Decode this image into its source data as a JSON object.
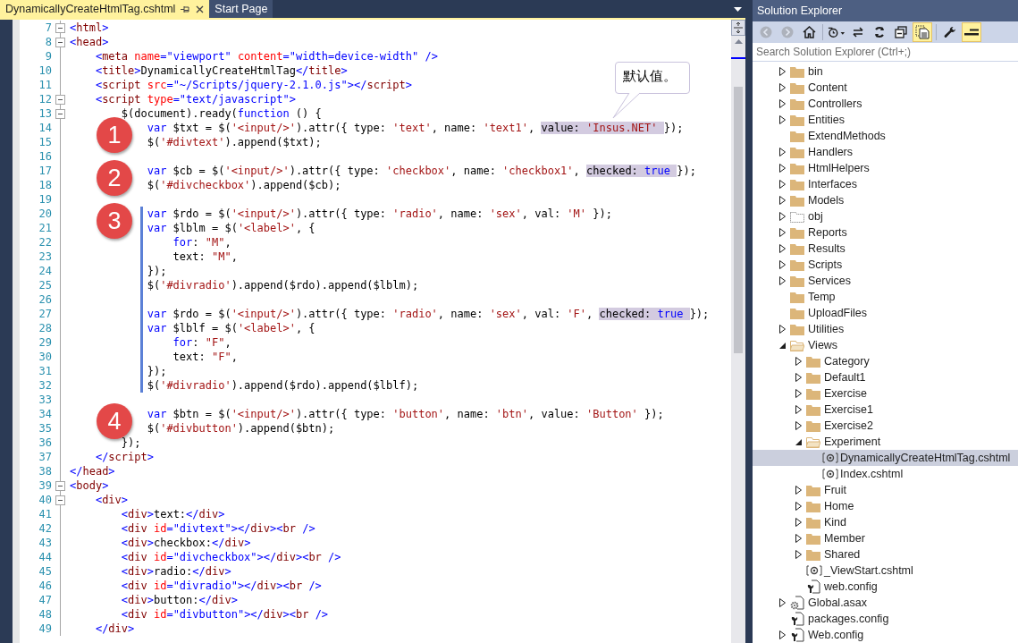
{
  "editor": {
    "tabs": [
      {
        "label": "DynamicallyCreateHtmlTag.cshtml",
        "selected": true
      },
      {
        "label": "Start Page",
        "selected": false
      }
    ],
    "callout": "默认值。",
    "lines": [
      {
        "number": "7",
        "fold": true,
        "changed": false,
        "tokens": [
          {
            "kind": "bracket",
            "text": "<"
          },
          {
            "kind": "tag",
            "text": "html"
          },
          {
            "kind": "bracket",
            "text": ">"
          }
        ]
      },
      {
        "number": "8",
        "fold": true,
        "changed": false,
        "tokens": [
          {
            "kind": "bracket",
            "text": "<"
          },
          {
            "kind": "tag",
            "text": "head"
          },
          {
            "kind": "bracket",
            "text": ">"
          }
        ]
      },
      {
        "number": "9",
        "fold": false,
        "changed": false,
        "tokens": [
          {
            "kind": "bracket",
            "text": "    <"
          },
          {
            "kind": "tag",
            "text": "meta"
          },
          {
            "kind": "attr",
            "text": " name"
          },
          {
            "kind": "bracket",
            "text": "="
          },
          {
            "kind": "attrval",
            "text": "\"viewport\""
          },
          {
            "kind": "attr",
            "text": " content"
          },
          {
            "kind": "bracket",
            "text": "="
          },
          {
            "kind": "attrval",
            "text": "\"width=device-width\""
          },
          {
            "kind": "bracket",
            "text": " />"
          }
        ]
      },
      {
        "number": "10",
        "fold": false,
        "changed": false,
        "tokens": [
          {
            "kind": "bracket",
            "text": "    <"
          },
          {
            "kind": "tag",
            "text": "title"
          },
          {
            "kind": "bracket",
            "text": ">"
          },
          {
            "kind": "plain",
            "text": "DynamicallyCreateHtmlTag"
          },
          {
            "kind": "bracket",
            "text": "</"
          },
          {
            "kind": "tag",
            "text": "title"
          },
          {
            "kind": "bracket",
            "text": ">"
          }
        ]
      },
      {
        "number": "11",
        "fold": false,
        "changed": false,
        "tokens": [
          {
            "kind": "bracket",
            "text": "    <"
          },
          {
            "kind": "tag",
            "text": "script"
          },
          {
            "kind": "attr",
            "text": " src"
          },
          {
            "kind": "bracket",
            "text": "="
          },
          {
            "kind": "attrval",
            "text": "\"~/Scripts/jquery-2.1.0.js\""
          },
          {
            "kind": "bracket",
            "text": "></"
          },
          {
            "kind": "tag",
            "text": "script"
          },
          {
            "kind": "bracket",
            "text": ">"
          }
        ]
      },
      {
        "number": "12",
        "fold": true,
        "changed": false,
        "tokens": [
          {
            "kind": "bracket",
            "text": "    <"
          },
          {
            "kind": "tag",
            "text": "script"
          },
          {
            "kind": "attr",
            "text": " type"
          },
          {
            "kind": "bracket",
            "text": "="
          },
          {
            "kind": "attrval",
            "text": "\"text/javascript\""
          },
          {
            "kind": "bracket",
            "text": ">"
          }
        ]
      },
      {
        "number": "13",
        "fold": true,
        "changed": false,
        "tokens": [
          {
            "kind": "plain",
            "text": "        $(document).ready("
          },
          {
            "kind": "keyword",
            "text": "function"
          },
          {
            "kind": "plain",
            "text": " () {"
          }
        ]
      },
      {
        "number": "14",
        "fold": false,
        "changed": false,
        "badge": "1",
        "tokens": [
          {
            "kind": "keyword",
            "text": "            var"
          },
          {
            "kind": "plain",
            "text": " $txt = $("
          },
          {
            "kind": "string",
            "text": "'<input/>'"
          },
          {
            "kind": "plain",
            "text": ").attr({ type: "
          },
          {
            "kind": "string",
            "text": "'text'"
          },
          {
            "kind": "plain",
            "text": ", name: "
          },
          {
            "kind": "string",
            "text": "'text1'"
          },
          {
            "kind": "plain",
            "text": ", "
          },
          {
            "kind": "mark",
            "parts": [
              {
                "kind": "plain",
                "text": "value: "
              },
              {
                "kind": "string",
                "text": "'Insus.NET' "
              }
            ]
          },
          {
            "kind": "plain",
            "text": "});"
          }
        ]
      },
      {
        "number": "15",
        "fold": false,
        "changed": false,
        "tokens": [
          {
            "kind": "plain",
            "text": "            $("
          },
          {
            "kind": "string",
            "text": "'#divtext'"
          },
          {
            "kind": "plain",
            "text": ").append($txt);"
          }
        ]
      },
      {
        "number": "16",
        "fold": false,
        "changed": false
      },
      {
        "number": "17",
        "fold": false,
        "changed": false,
        "badge": "2",
        "tokens": [
          {
            "kind": "keyword",
            "text": "            var"
          },
          {
            "kind": "plain",
            "text": " $cb = $("
          },
          {
            "kind": "string",
            "text": "'<input/>'"
          },
          {
            "kind": "plain",
            "text": ").attr({ type: "
          },
          {
            "kind": "string",
            "text": "'checkbox'"
          },
          {
            "kind": "plain",
            "text": ", name: "
          },
          {
            "kind": "string",
            "text": "'checkbox1'"
          },
          {
            "kind": "plain",
            "text": ", "
          },
          {
            "kind": "mark",
            "parts": [
              {
                "kind": "plain",
                "text": "checked: "
              },
              {
                "kind": "keyword",
                "text": "true "
              }
            ]
          },
          {
            "kind": "plain",
            "text": "});"
          }
        ]
      },
      {
        "number": "18",
        "fold": false,
        "changed": false,
        "tokens": [
          {
            "kind": "plain",
            "text": "            $("
          },
          {
            "kind": "string",
            "text": "'#divcheckbox'"
          },
          {
            "kind": "plain",
            "text": ").append($cb);"
          }
        ]
      },
      {
        "number": "19",
        "fold": false,
        "changed": false
      },
      {
        "number": "20",
        "fold": false,
        "changed": true,
        "badge": "3",
        "tokens": [
          {
            "kind": "keyword",
            "text": "            var"
          },
          {
            "kind": "plain",
            "text": " $rdo = $("
          },
          {
            "kind": "string",
            "text": "'<input/>'"
          },
          {
            "kind": "plain",
            "text": ").attr({ type: "
          },
          {
            "kind": "string",
            "text": "'radio'"
          },
          {
            "kind": "plain",
            "text": ", name: "
          },
          {
            "kind": "string",
            "text": "'sex'"
          },
          {
            "kind": "plain",
            "text": ", val: "
          },
          {
            "kind": "string",
            "text": "'M'"
          },
          {
            "kind": "plain",
            "text": " });"
          }
        ]
      },
      {
        "number": "21",
        "fold": false,
        "changed": true,
        "tokens": [
          {
            "kind": "keyword",
            "text": "            var"
          },
          {
            "kind": "plain",
            "text": " $lblm = $("
          },
          {
            "kind": "string",
            "text": "'<label>'"
          },
          {
            "kind": "plain",
            "text": ", {"
          }
        ]
      },
      {
        "number": "22",
        "fold": false,
        "changed": true,
        "tokens": [
          {
            "kind": "keyword",
            "text": "                for"
          },
          {
            "kind": "plain",
            "text": ": "
          },
          {
            "kind": "string",
            "text": "\"M\""
          },
          {
            "kind": "plain",
            "text": ","
          }
        ]
      },
      {
        "number": "23",
        "fold": false,
        "changed": true,
        "tokens": [
          {
            "kind": "plain",
            "text": "                text: "
          },
          {
            "kind": "string",
            "text": "\"M\""
          },
          {
            "kind": "plain",
            "text": ","
          }
        ]
      },
      {
        "number": "24",
        "fold": false,
        "changed": true,
        "tokens": [
          {
            "kind": "plain",
            "text": "            });"
          }
        ]
      },
      {
        "number": "25",
        "fold": false,
        "changed": true,
        "tokens": [
          {
            "kind": "plain",
            "text": "            $("
          },
          {
            "kind": "string",
            "text": "'#divradio'"
          },
          {
            "kind": "plain",
            "text": ").append($rdo).append($lblm);"
          }
        ]
      },
      {
        "number": "26",
        "fold": false,
        "changed": true
      },
      {
        "number": "27",
        "fold": false,
        "changed": true,
        "tokens": [
          {
            "kind": "keyword",
            "text": "            var"
          },
          {
            "kind": "plain",
            "text": " $rdo = $("
          },
          {
            "kind": "string",
            "text": "'<input/>'"
          },
          {
            "kind": "plain",
            "text": ").attr({ type: "
          },
          {
            "kind": "string",
            "text": "'radio'"
          },
          {
            "kind": "plain",
            "text": ", name: "
          },
          {
            "kind": "string",
            "text": "'sex'"
          },
          {
            "kind": "plain",
            "text": ", val: "
          },
          {
            "kind": "string",
            "text": "'F'"
          },
          {
            "kind": "plain",
            "text": ", "
          },
          {
            "kind": "mark",
            "parts": [
              {
                "kind": "plain",
                "text": "checked: "
              },
              {
                "kind": "keyword",
                "text": "true "
              }
            ]
          },
          {
            "kind": "plain",
            "text": "});"
          }
        ]
      },
      {
        "number": "28",
        "fold": false,
        "changed": true,
        "tokens": [
          {
            "kind": "keyword",
            "text": "            var"
          },
          {
            "kind": "plain",
            "text": " $lblf = $("
          },
          {
            "kind": "string",
            "text": "'<label>'"
          },
          {
            "kind": "plain",
            "text": ", {"
          }
        ]
      },
      {
        "number": "29",
        "fold": false,
        "changed": true,
        "tokens": [
          {
            "kind": "keyword",
            "text": "                for"
          },
          {
            "kind": "plain",
            "text": ": "
          },
          {
            "kind": "string",
            "text": "\"F\""
          },
          {
            "kind": "plain",
            "text": ","
          }
        ]
      },
      {
        "number": "30",
        "fold": false,
        "changed": true,
        "tokens": [
          {
            "kind": "plain",
            "text": "                text: "
          },
          {
            "kind": "string",
            "text": "\"F\""
          },
          {
            "kind": "plain",
            "text": ","
          }
        ]
      },
      {
        "number": "31",
        "fold": false,
        "changed": true,
        "tokens": [
          {
            "kind": "plain",
            "text": "            });"
          }
        ]
      },
      {
        "number": "32",
        "fold": false,
        "changed": true,
        "tokens": [
          {
            "kind": "plain",
            "text": "            $("
          },
          {
            "kind": "string",
            "text": "'#divradio'"
          },
          {
            "kind": "plain",
            "text": ").append($rdo).append($lblf);"
          }
        ]
      },
      {
        "number": "33",
        "fold": false,
        "changed": false
      },
      {
        "number": "34",
        "fold": false,
        "changed": false,
        "badge": "4",
        "tokens": [
          {
            "kind": "keyword",
            "text": "            var"
          },
          {
            "kind": "plain",
            "text": " $btn = $("
          },
          {
            "kind": "string",
            "text": "'<input/>'"
          },
          {
            "kind": "plain",
            "text": ").attr({ type: "
          },
          {
            "kind": "string",
            "text": "'button'"
          },
          {
            "kind": "plain",
            "text": ", name: "
          },
          {
            "kind": "string",
            "text": "'btn'"
          },
          {
            "kind": "plain",
            "text": ", value: "
          },
          {
            "kind": "string",
            "text": "'Button'"
          },
          {
            "kind": "plain",
            "text": " });"
          }
        ]
      },
      {
        "number": "35",
        "fold": false,
        "changed": false,
        "tokens": [
          {
            "kind": "plain",
            "text": "            $("
          },
          {
            "kind": "string",
            "text": "'#divbutton'"
          },
          {
            "kind": "plain",
            "text": ").append($btn);"
          }
        ]
      },
      {
        "number": "36",
        "fold": false,
        "changed": false,
        "tokens": [
          {
            "kind": "plain",
            "text": "        });"
          }
        ]
      },
      {
        "number": "37",
        "fold": false,
        "changed": false,
        "tokens": [
          {
            "kind": "bracket",
            "text": "    </"
          },
          {
            "kind": "tag",
            "text": "script"
          },
          {
            "kind": "bracket",
            "text": ">"
          }
        ]
      },
      {
        "number": "38",
        "fold": false,
        "changed": false,
        "tokens": [
          {
            "kind": "bracket",
            "text": "</"
          },
          {
            "kind": "tag",
            "text": "head"
          },
          {
            "kind": "bracket",
            "text": ">"
          }
        ]
      },
      {
        "number": "39",
        "fold": true,
        "changed": false,
        "tokens": [
          {
            "kind": "bracket",
            "text": "<"
          },
          {
            "kind": "tag",
            "text": "body"
          },
          {
            "kind": "bracket",
            "text": ">"
          }
        ]
      },
      {
        "number": "40",
        "fold": true,
        "changed": false,
        "tokens": [
          {
            "kind": "bracket",
            "text": "    <"
          },
          {
            "kind": "tag",
            "text": "div"
          },
          {
            "kind": "bracket",
            "text": ">"
          }
        ]
      },
      {
        "number": "41",
        "fold": false,
        "changed": false,
        "tokens": [
          {
            "kind": "bracket",
            "text": "        <"
          },
          {
            "kind": "tag",
            "text": "div"
          },
          {
            "kind": "bracket",
            "text": ">"
          },
          {
            "kind": "plain",
            "text": "text:"
          },
          {
            "kind": "bracket",
            "text": "</"
          },
          {
            "kind": "tag",
            "text": "div"
          },
          {
            "kind": "bracket",
            "text": ">"
          }
        ]
      },
      {
        "number": "42",
        "fold": false,
        "changed": false,
        "tokens": [
          {
            "kind": "bracket",
            "text": "        <"
          },
          {
            "kind": "tag",
            "text": "div"
          },
          {
            "kind": "attr",
            "text": " id"
          },
          {
            "kind": "bracket",
            "text": "="
          },
          {
            "kind": "attrval",
            "text": "\"divtext\""
          },
          {
            "kind": "bracket",
            "text": "></"
          },
          {
            "kind": "tag",
            "text": "div"
          },
          {
            "kind": "bracket",
            "text": "><"
          },
          {
            "kind": "tag",
            "text": "br"
          },
          {
            "kind": "bracket",
            "text": " />"
          }
        ]
      },
      {
        "number": "43",
        "fold": false,
        "changed": false,
        "tokens": [
          {
            "kind": "bracket",
            "text": "        <"
          },
          {
            "kind": "tag",
            "text": "div"
          },
          {
            "kind": "bracket",
            "text": ">"
          },
          {
            "kind": "plain",
            "text": "checkbox:"
          },
          {
            "kind": "bracket",
            "text": "</"
          },
          {
            "kind": "tag",
            "text": "div"
          },
          {
            "kind": "bracket",
            "text": ">"
          }
        ]
      },
      {
        "number": "44",
        "fold": false,
        "changed": false,
        "tokens": [
          {
            "kind": "bracket",
            "text": "        <"
          },
          {
            "kind": "tag",
            "text": "div"
          },
          {
            "kind": "attr",
            "text": " id"
          },
          {
            "kind": "bracket",
            "text": "="
          },
          {
            "kind": "attrval",
            "text": "\"divcheckbox\""
          },
          {
            "kind": "bracket",
            "text": "></"
          },
          {
            "kind": "tag",
            "text": "div"
          },
          {
            "kind": "bracket",
            "text": "><"
          },
          {
            "kind": "tag",
            "text": "br"
          },
          {
            "kind": "bracket",
            "text": " />"
          }
        ]
      },
      {
        "number": "45",
        "fold": false,
        "changed": false,
        "tokens": [
          {
            "kind": "bracket",
            "text": "        <"
          },
          {
            "kind": "tag",
            "text": "div"
          },
          {
            "kind": "bracket",
            "text": ">"
          },
          {
            "kind": "plain",
            "text": "radio:"
          },
          {
            "kind": "bracket",
            "text": "</"
          },
          {
            "kind": "tag",
            "text": "div"
          },
          {
            "kind": "bracket",
            "text": ">"
          }
        ]
      },
      {
        "number": "46",
        "fold": false,
        "changed": false,
        "tokens": [
          {
            "kind": "bracket",
            "text": "        <"
          },
          {
            "kind": "tag",
            "text": "div"
          },
          {
            "kind": "attr",
            "text": " id"
          },
          {
            "kind": "bracket",
            "text": "="
          },
          {
            "kind": "attrval",
            "text": "\"divradio\""
          },
          {
            "kind": "bracket",
            "text": "></"
          },
          {
            "kind": "tag",
            "text": "div"
          },
          {
            "kind": "bracket",
            "text": "><"
          },
          {
            "kind": "tag",
            "text": "br"
          },
          {
            "kind": "bracket",
            "text": " />"
          }
        ]
      },
      {
        "number": "47",
        "fold": false,
        "changed": false,
        "tokens": [
          {
            "kind": "bracket",
            "text": "        <"
          },
          {
            "kind": "tag",
            "text": "div"
          },
          {
            "kind": "bracket",
            "text": ">"
          },
          {
            "kind": "plain",
            "text": "button:"
          },
          {
            "kind": "bracket",
            "text": "</"
          },
          {
            "kind": "tag",
            "text": "div"
          },
          {
            "kind": "bracket",
            "text": ">"
          }
        ]
      },
      {
        "number": "48",
        "fold": false,
        "changed": false,
        "tokens": [
          {
            "kind": "bracket",
            "text": "        <"
          },
          {
            "kind": "tag",
            "text": "div"
          },
          {
            "kind": "attr",
            "text": " id"
          },
          {
            "kind": "bracket",
            "text": "="
          },
          {
            "kind": "attrval",
            "text": "\"divbutton\""
          },
          {
            "kind": "bracket",
            "text": "></"
          },
          {
            "kind": "tag",
            "text": "div"
          },
          {
            "kind": "bracket",
            "text": "><"
          },
          {
            "kind": "tag",
            "text": "br"
          },
          {
            "kind": "bracket",
            "text": " />"
          }
        ]
      },
      {
        "number": "49",
        "fold": false,
        "changed": false,
        "tokens": [
          {
            "kind": "bracket",
            "text": "    </"
          },
          {
            "kind": "tag",
            "text": "div"
          },
          {
            "kind": "bracket",
            "text": ">"
          }
        ]
      }
    ]
  },
  "solution_explorer": {
    "title": "Solution Explorer",
    "toolbar_groups": [
      {
        "buttons": [
          {
            "kind": "back",
            "disabled": true,
            "on": false
          },
          {
            "kind": "forward",
            "disabled": true,
            "on": false
          },
          {
            "kind": "home",
            "disabled": false,
            "on": false
          }
        ]
      },
      {
        "buttons": [
          {
            "kind": "history",
            "disabled": false,
            "on": false
          },
          {
            "kind": "sync",
            "disabled": false,
            "on": false
          },
          {
            "kind": "refresh",
            "disabled": false,
            "on": false
          },
          {
            "kind": "collapse",
            "disabled": false,
            "on": false
          },
          {
            "kind": "show_all",
            "disabled": false,
            "on": true
          }
        ]
      },
      {
        "buttons": [
          {
            "kind": "properties",
            "disabled": false,
            "on": false
          },
          {
            "kind": "preview",
            "disabled": false,
            "on": true
          }
        ]
      }
    ],
    "search": {
      "placeholder": "Search Solution Explorer (Ctrl+;)"
    },
    "tree": [
      {
        "label": "bin",
        "kind": "folder",
        "expandable": true,
        "expanded": false,
        "selected": false
      },
      {
        "label": "Content",
        "kind": "folder",
        "expandable": true,
        "expanded": false,
        "selected": false
      },
      {
        "label": "Controllers",
        "kind": "folder",
        "expandable": true,
        "expanded": false,
        "selected": false
      },
      {
        "label": "Entities",
        "kind": "folder",
        "expandable": true,
        "expanded": false,
        "selected": false
      },
      {
        "label": "ExtendMethods",
        "kind": "folder",
        "expandable": false,
        "expanded": false,
        "selected": false
      },
      {
        "label": "Handlers",
        "kind": "folder",
        "expandable": true,
        "expanded": false,
        "selected": false
      },
      {
        "label": "HtmlHelpers",
        "kind": "folder",
        "expandable": true,
        "expanded": false,
        "selected": false
      },
      {
        "label": "Interfaces",
        "kind": "folder",
        "expandable": true,
        "expanded": false,
        "selected": false
      },
      {
        "label": "Models",
        "kind": "folder",
        "expandable": true,
        "expanded": false,
        "selected": false
      },
      {
        "label": "obj",
        "kind": "hidden_folder",
        "expandable": true,
        "expanded": false,
        "selected": false
      },
      {
        "label": "Reports",
        "kind": "folder",
        "expandable": true,
        "expanded": false,
        "selected": false
      },
      {
        "label": "Results",
        "kind": "folder",
        "expandable": true,
        "expanded": false,
        "selected": false
      },
      {
        "label": "Scripts",
        "kind": "folder",
        "expandable": true,
        "expanded": false,
        "selected": false
      },
      {
        "label": "Services",
        "kind": "folder",
        "expandable": true,
        "expanded": false,
        "selected": false
      },
      {
        "label": "Temp",
        "kind": "folder",
        "expandable": false,
        "expanded": false,
        "selected": false
      },
      {
        "label": "UploadFiles",
        "kind": "folder",
        "expandable": false,
        "expanded": false,
        "selected": false
      },
      {
        "label": "Utilities",
        "kind": "folder",
        "expandable": true,
        "expanded": false,
        "selected": false
      },
      {
        "label": "Views",
        "kind": "folder",
        "expandable": true,
        "expanded": true,
        "selected": false,
        "children": [
          {
            "label": "Category",
            "kind": "folder",
            "expandable": true,
            "expanded": false,
            "selected": false
          },
          {
            "label": "Default1",
            "kind": "folder",
            "expandable": true,
            "expanded": false,
            "selected": false
          },
          {
            "label": "Exercise",
            "kind": "folder",
            "expandable": true,
            "expanded": false,
            "selected": false
          },
          {
            "label": "Exercise1",
            "kind": "folder",
            "expandable": true,
            "expanded": false,
            "selected": false
          },
          {
            "label": "Exercise2",
            "kind": "folder",
            "expandable": true,
            "expanded": false,
            "selected": false
          },
          {
            "label": "Experiment",
            "kind": "folder",
            "expandable": true,
            "expanded": true,
            "selected": false,
            "children": [
              {
                "label": "DynamicallyCreateHtmlTag.cshtml",
                "kind": "razor",
                "expandable": false,
                "expanded": false,
                "selected": true
              },
              {
                "label": "Index.cshtml",
                "kind": "razor",
                "expandable": false,
                "expanded": false,
                "selected": false
              }
            ]
          },
          {
            "label": "Fruit",
            "kind": "folder",
            "expandable": true,
            "expanded": false,
            "selected": false
          },
          {
            "label": "Home",
            "kind": "folder",
            "expandable": true,
            "expanded": false,
            "selected": false
          },
          {
            "label": "Kind",
            "kind": "folder",
            "expandable": true,
            "expanded": false,
            "selected": false
          },
          {
            "label": "Member",
            "kind": "folder",
            "expandable": true,
            "expanded": false,
            "selected": false
          },
          {
            "label": "Shared",
            "kind": "folder",
            "expandable": true,
            "expanded": false,
            "selected": false
          },
          {
            "label": "_ViewStart.cshtml",
            "kind": "razor",
            "expandable": false,
            "expanded": false,
            "selected": false
          },
          {
            "label": "web.config",
            "kind": "config",
            "expandable": false,
            "expanded": false,
            "selected": false
          }
        ]
      },
      {
        "label": "Global.asax",
        "kind": "asax",
        "expandable": true,
        "expanded": false,
        "selected": false
      },
      {
        "label": "packages.config",
        "kind": "config",
        "expandable": false,
        "expanded": false,
        "selected": false
      },
      {
        "label": "Web.config",
        "kind": "config",
        "expandable": true,
        "expanded": false,
        "selected": false
      }
    ]
  }
}
